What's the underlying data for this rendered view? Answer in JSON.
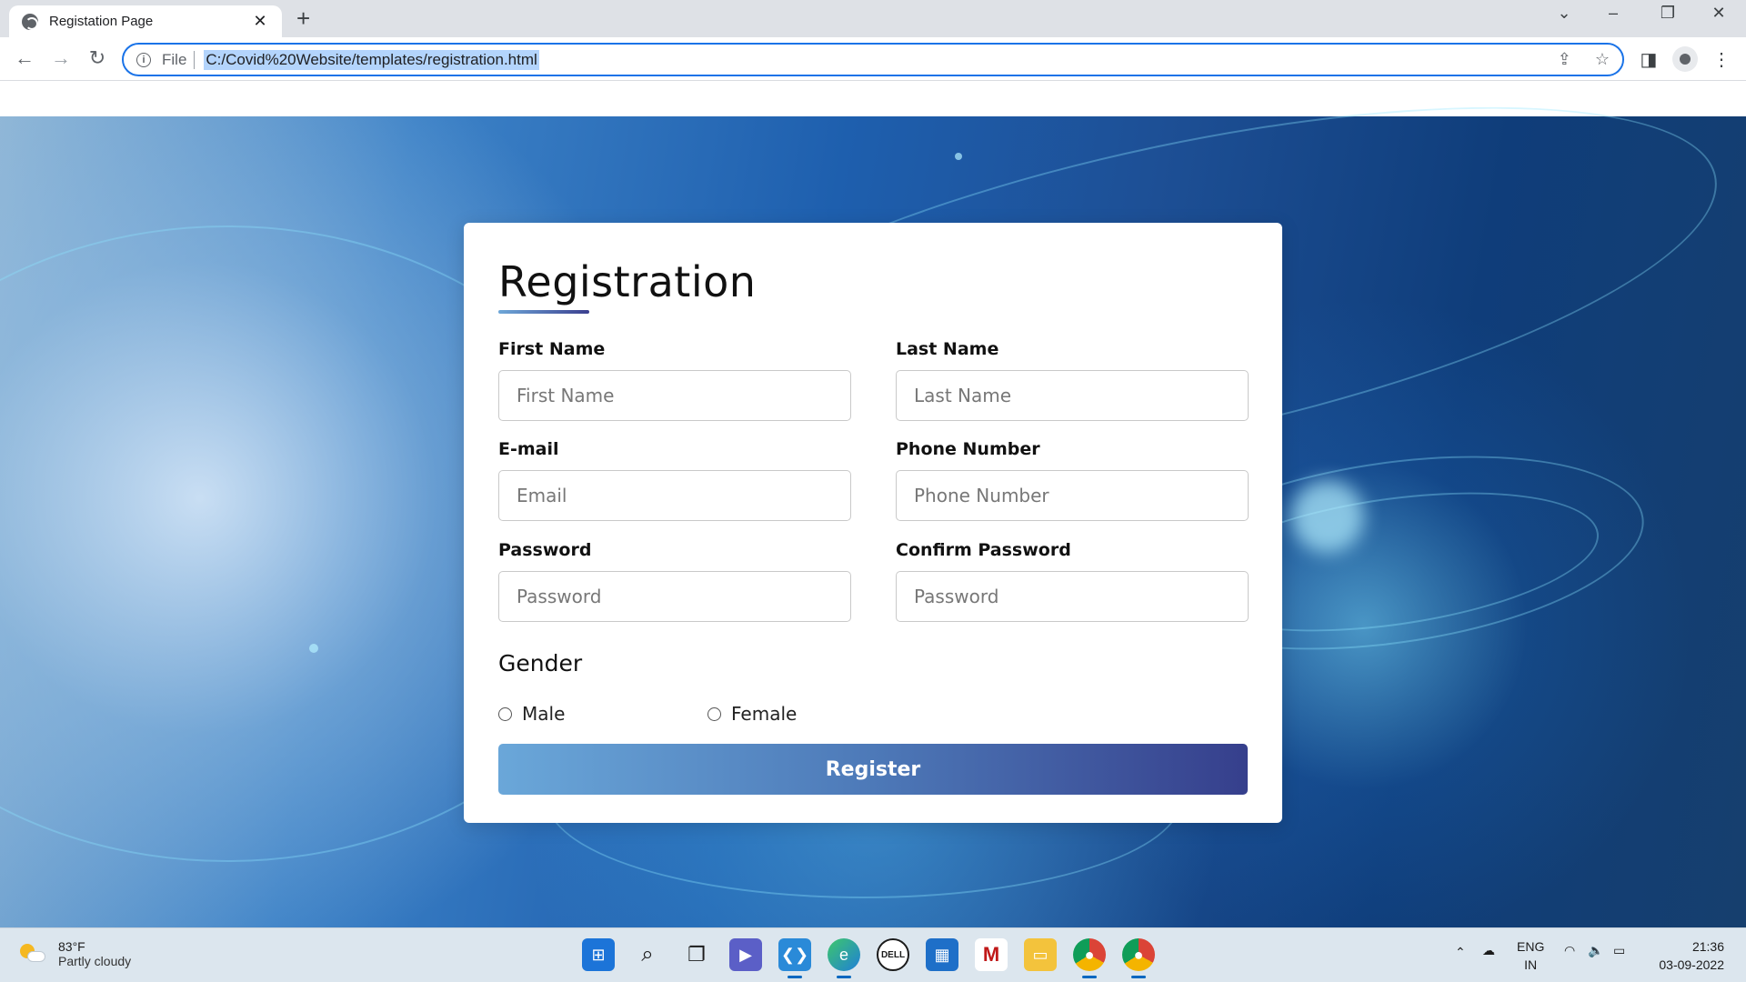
{
  "browser": {
    "tab_title": "Registation Page",
    "tab_close": "✕",
    "new_tab": "+",
    "scheme": "File",
    "url": "C:/Covid%20Website/templates/registration.html",
    "info_icon": "i"
  },
  "form": {
    "title": "Registration",
    "first_name_label": "First Name",
    "first_name_placeholder": "First Name",
    "last_name_label": "Last Name",
    "last_name_placeholder": "Last Name",
    "email_label": "E-mail",
    "email_placeholder": "Email",
    "phone_label": "Phone Number",
    "phone_placeholder": "Phone Number",
    "password_label": "Password",
    "password_placeholder": "Password",
    "confirm_label": "Confirm Password",
    "confirm_placeholder": "Password",
    "gender_label": "Gender",
    "gender_options": [
      "Male",
      "Female"
    ],
    "submit_label": "Register",
    "accent_start": "#6aa7d9",
    "accent_end": "#363f8c"
  },
  "taskbar": {
    "weather_temp": "83°F",
    "weather_condition": "Partly cloudy",
    "language": "ENG",
    "region": "IN",
    "time": "21:36",
    "date": "03-09-2022",
    "apps": [
      "start-icon",
      "search-icon",
      "task-view-icon",
      "teams-icon",
      "vscode-icon",
      "edge-icon",
      "dell-icon",
      "store-icon",
      "mcafee-icon",
      "file-explorer-icon",
      "chrome-profile-icon",
      "chrome-icon"
    ]
  }
}
